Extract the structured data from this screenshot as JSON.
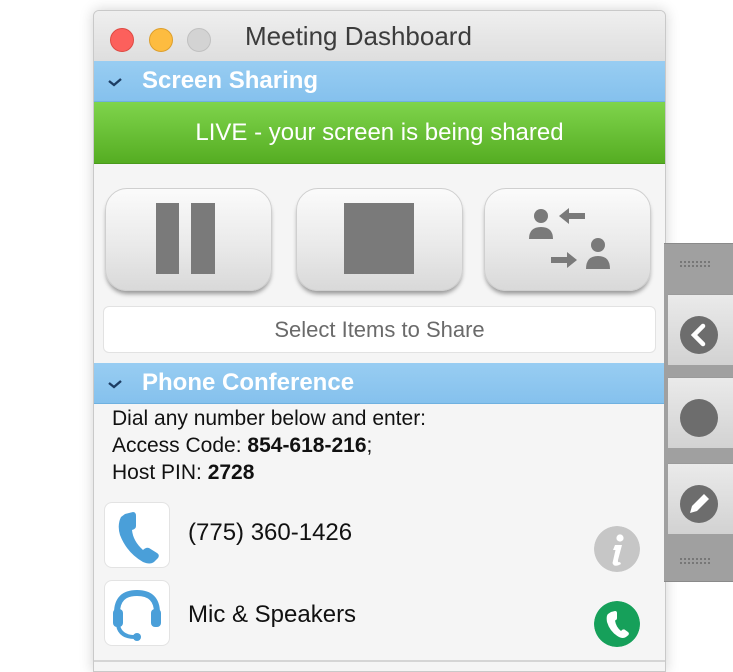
{
  "window": {
    "title": "Meeting Dashboard"
  },
  "screen_sharing": {
    "header": "Screen Sharing",
    "live_text": "LIVE - your screen is being shared",
    "select_items_label": "Select Items to Share"
  },
  "phone_conference": {
    "header": "Phone Conference",
    "instructions": "Dial any number below and enter:",
    "access_code_label": "Access Code: ",
    "access_code": "854-618-216",
    "access_code_suffix": ";",
    "host_pin_label": "Host PIN: ",
    "host_pin": "2728",
    "phone_number": "(775) 360-1426",
    "audio_option": "Mic & Speakers"
  },
  "colors": {
    "section_header": "#8ac5ef",
    "live_green": "#63b92e",
    "call_green": "#16a05a",
    "info_gray": "#c6c6c6"
  }
}
